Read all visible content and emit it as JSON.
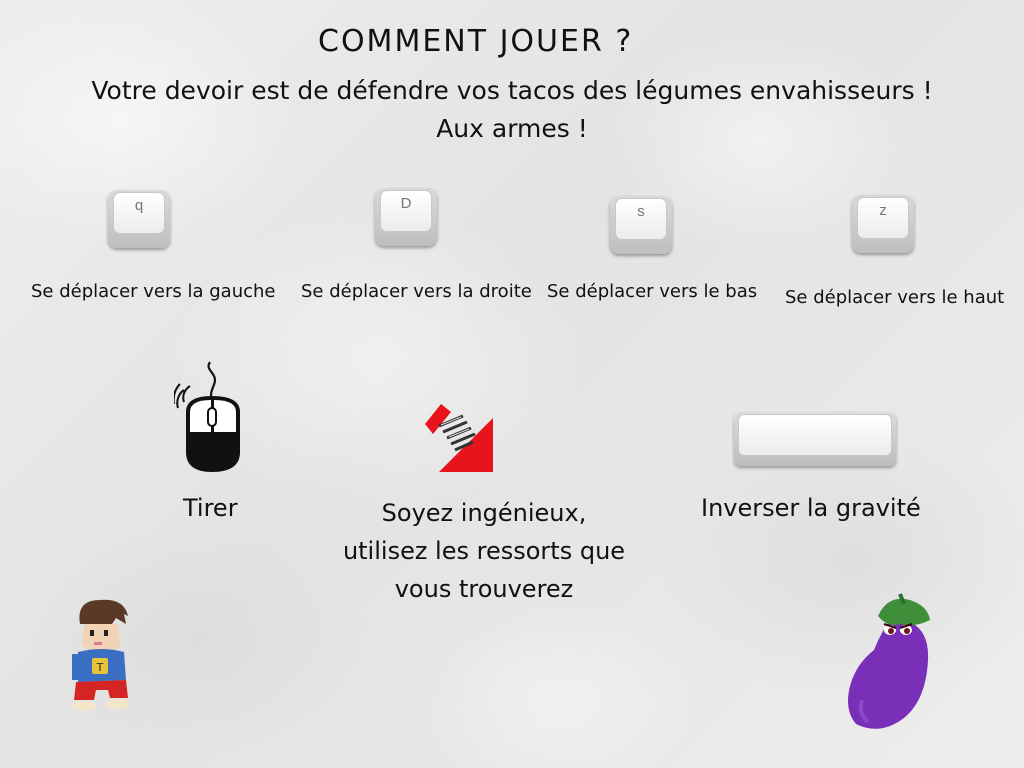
{
  "screen": {
    "title": "COMMENT JOUER ?",
    "intro_line1": "Votre devoir est de défendre vos tacos des légumes envahisseurs !",
    "intro_line2": "Aux armes !"
  },
  "keys": [
    {
      "key": "q",
      "label": "Se déplacer vers la gauche"
    },
    {
      "key": "D",
      "label": "Se déplacer vers la droite"
    },
    {
      "key": "s",
      "label": "Se déplacer vers le bas"
    },
    {
      "key": "z",
      "label": "Se déplacer vers le haut"
    }
  ],
  "actions": {
    "shoot_label": "Tirer",
    "spring_label": "Soyez ingénieux, utilisez les ressorts que vous trouverez",
    "gravity_label": "Inverser la gravité"
  },
  "icons": {
    "mouse": "mouse-icon",
    "spring": "spring-icon",
    "spacebar": "spacebar-key-icon",
    "player": "player-character",
    "enemy": "eggplant-enemy"
  },
  "colors": {
    "spring_red": "#e8141c",
    "eggplant_purple": "#7a2fb8",
    "eggplant_stem": "#3f8f3a",
    "player_shirt": "#3a6fc4",
    "player_pants": "#d42424"
  }
}
